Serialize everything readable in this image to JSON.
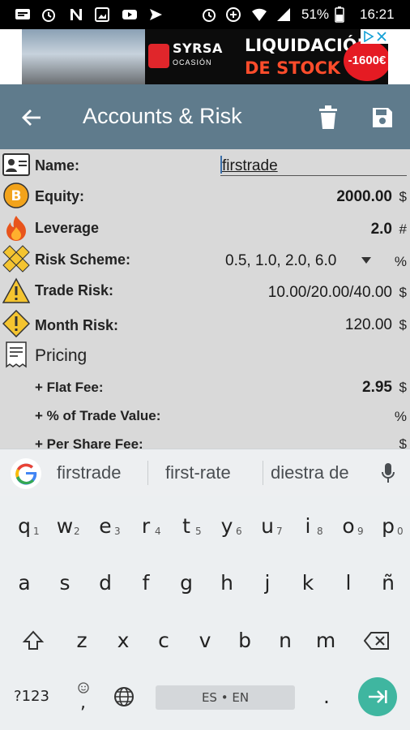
{
  "status_bar": {
    "battery": "51%",
    "time": "16:21"
  },
  "ad": {
    "brand": "SYRSA",
    "brand_sub": "OCASIÓN",
    "headline_1": "LIQUIDACIÓN",
    "headline_2": "DE STOCK",
    "price_badge": "-1600€"
  },
  "toolbar": {
    "title": "Accounts & Risk",
    "back_icon": "arrow-left-icon",
    "delete_icon": "trash-icon",
    "save_icon": "floppy-disk-icon"
  },
  "form": {
    "name": {
      "label": "Name:",
      "value": "firstrade"
    },
    "equity": {
      "label": "Equity:",
      "value": "2000.00",
      "unit": "$"
    },
    "leverage": {
      "label": "Leverage",
      "value": "2.0",
      "unit": "#"
    },
    "risk_scheme": {
      "label": "Risk Scheme:",
      "value": "0.5, 1.0, 2.0, 6.0",
      "unit": "%"
    },
    "trade_risk": {
      "label": "Trade Risk:",
      "value": "10.00/20.00/40.00",
      "unit": "$"
    },
    "month_risk": {
      "label": "Month Risk:",
      "value": "120.00",
      "unit": "$"
    },
    "pricing": {
      "label": "Pricing"
    },
    "flat_fee": {
      "label": "+ Flat Fee:",
      "value": "2.95",
      "unit": "$"
    },
    "pct_trade_value": {
      "label": "+ % of Trade Value:",
      "unit": "%"
    },
    "per_share_fee": {
      "label": "+ Per Share Fee:",
      "unit": "$"
    }
  },
  "suggestions": [
    "firstrade",
    "first-rate",
    "diestra de"
  ],
  "keyboard": {
    "row1": [
      "q",
      "w",
      "e",
      "r",
      "t",
      "y",
      "u",
      "i",
      "o",
      "p"
    ],
    "row1_hints": [
      "1",
      "2",
      "3",
      "4",
      "5",
      "6",
      "7",
      "8",
      "9",
      "0"
    ],
    "row2": [
      "a",
      "s",
      "d",
      "f",
      "g",
      "h",
      "j",
      "k",
      "l",
      "ñ"
    ],
    "row3": [
      "z",
      "x",
      "c",
      "v",
      "b",
      "n",
      "m"
    ],
    "symbols_key": "?123",
    "space_label": "ES • EN",
    "period": "."
  },
  "colors": {
    "toolbar": "#5f7b8c",
    "form_bg": "#d9d9d9",
    "enter_key": "#3fb6a0"
  }
}
